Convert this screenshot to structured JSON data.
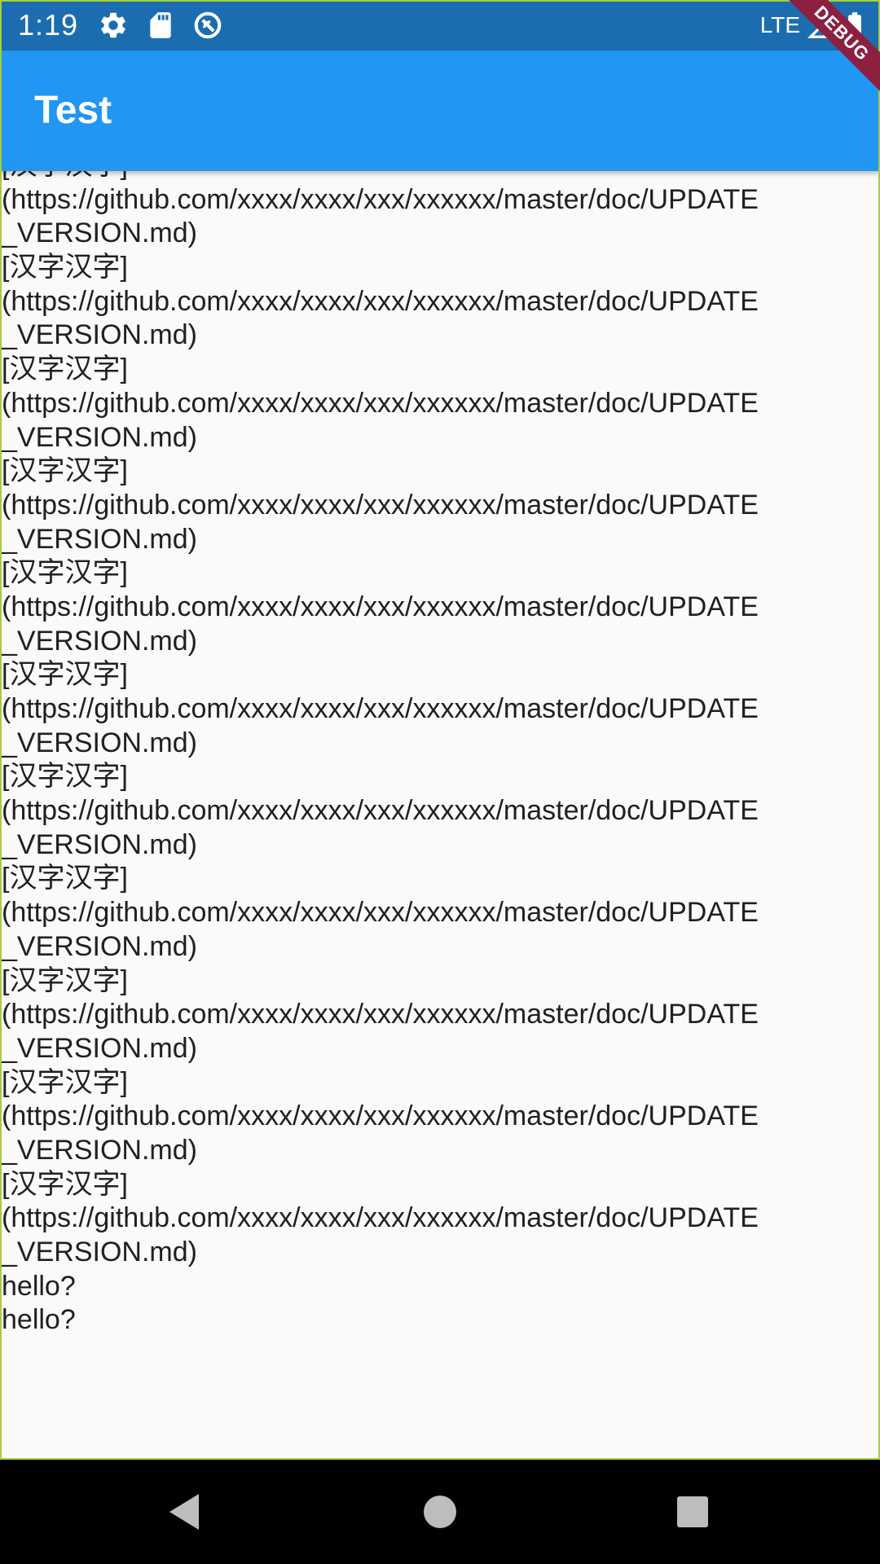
{
  "status_bar": {
    "time": "1:19",
    "network": "LTE",
    "icons": [
      "settings-icon",
      "sd-card-icon",
      "no-disturb-icon",
      "signal-icon",
      "battery-icon"
    ]
  },
  "app_bar": {
    "title": "Test"
  },
  "debug_banner": "DEBUG",
  "content": {
    "lines": [
      "[汉字汉字]",
      "(https://github.com/xxxx/xxxx/xxx/xxxxxx/master/doc/UPDATE",
      "_VERSION.md)",
      "[汉字汉字]",
      "(https://github.com/xxxx/xxxx/xxx/xxxxxx/master/doc/UPDATE",
      "_VERSION.md)",
      "[汉字汉字]",
      "(https://github.com/xxxx/xxxx/xxx/xxxxxx/master/doc/UPDATE",
      "_VERSION.md)",
      "[汉字汉字]",
      "(https://github.com/xxxx/xxxx/xxx/xxxxxx/master/doc/UPDATE",
      "_VERSION.md)",
      "[汉字汉字]",
      "(https://github.com/xxxx/xxxx/xxx/xxxxxx/master/doc/UPDATE",
      "_VERSION.md)",
      "[汉字汉字]",
      "(https://github.com/xxxx/xxxx/xxx/xxxxxx/master/doc/UPDATE",
      "_VERSION.md)",
      "[汉字汉字]",
      "(https://github.com/xxxx/xxxx/xxx/xxxxxx/master/doc/UPDATE",
      "_VERSION.md)",
      "[汉字汉字]",
      "(https://github.com/xxxx/xxxx/xxx/xxxxxx/master/doc/UPDATE",
      "_VERSION.md)",
      "[汉字汉字]",
      "(https://github.com/xxxx/xxxx/xxx/xxxxxx/master/doc/UPDATE",
      "_VERSION.md)",
      "[汉字汉字]",
      "(https://github.com/xxxx/xxxx/xxx/xxxxxx/master/doc/UPDATE",
      "_VERSION.md)",
      "[汉字汉字]",
      "(https://github.com/xxxx/xxxx/xxx/xxxxxx/master/doc/UPDATE",
      "_VERSION.md)",
      "hello?",
      "hello?"
    ]
  },
  "nav_bar": {
    "icons": [
      "back-icon",
      "home-icon",
      "recents-icon"
    ]
  },
  "colors": {
    "status_bar": "#1c6db0",
    "app_bar": "#2196f3",
    "background": "#fafafa",
    "text": "#202020",
    "debug_banner": "#8b2040",
    "outline": "#a6cf3b"
  }
}
